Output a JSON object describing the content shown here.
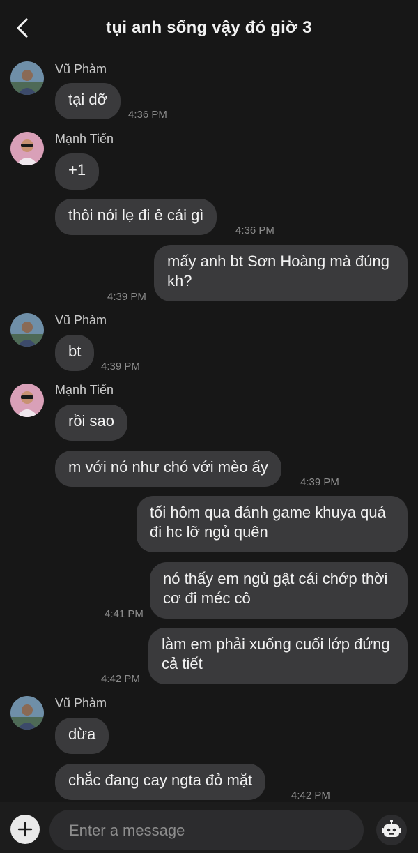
{
  "header": {
    "title": "tụi anh sống vậy đó giờ  3",
    "back_icon": "chevron-left-icon"
  },
  "senders": {
    "vu": "Vũ Phàm",
    "manh": "Mạnh Tiến"
  },
  "messages": [
    {
      "text": "tại dỡ",
      "time": "4:36 PM"
    },
    {
      "text": "+1"
    },
    {
      "text": "thôi nói lẹ đi ê cái gì",
      "time": "4:36 PM"
    },
    {
      "text": "mấy anh bt Sơn Hoàng mà đúng kh?",
      "time": "4:39 PM"
    },
    {
      "text": "bt",
      "time": "4:39 PM"
    },
    {
      "text": "rồi sao"
    },
    {
      "text": "m với nó như chó với mèo ấy",
      "time": "4:39 PM"
    },
    {
      "text": "tối hôm qua đánh game khuya quá đi hc lỡ ngủ quên"
    },
    {
      "text": "nó thấy em ngủ gật cái chớp thời cơ đi méc cô",
      "time": "4:41 PM"
    },
    {
      "text": "làm em phải xuống cuối lớp đứng cả tiết",
      "time": "4:42 PM"
    },
    {
      "text": "dừa"
    },
    {
      "text": "chắc đang cay ngta đỏ mặt",
      "time": "4:42 PM"
    }
  ],
  "composer": {
    "placeholder": "Enter a message",
    "value": "",
    "plus_icon": "plus-icon",
    "bot_icon": "robot-icon"
  },
  "colors": {
    "background": "#171717",
    "bubble": "#3a3a3c",
    "timestamp": "#8c8c8c"
  }
}
